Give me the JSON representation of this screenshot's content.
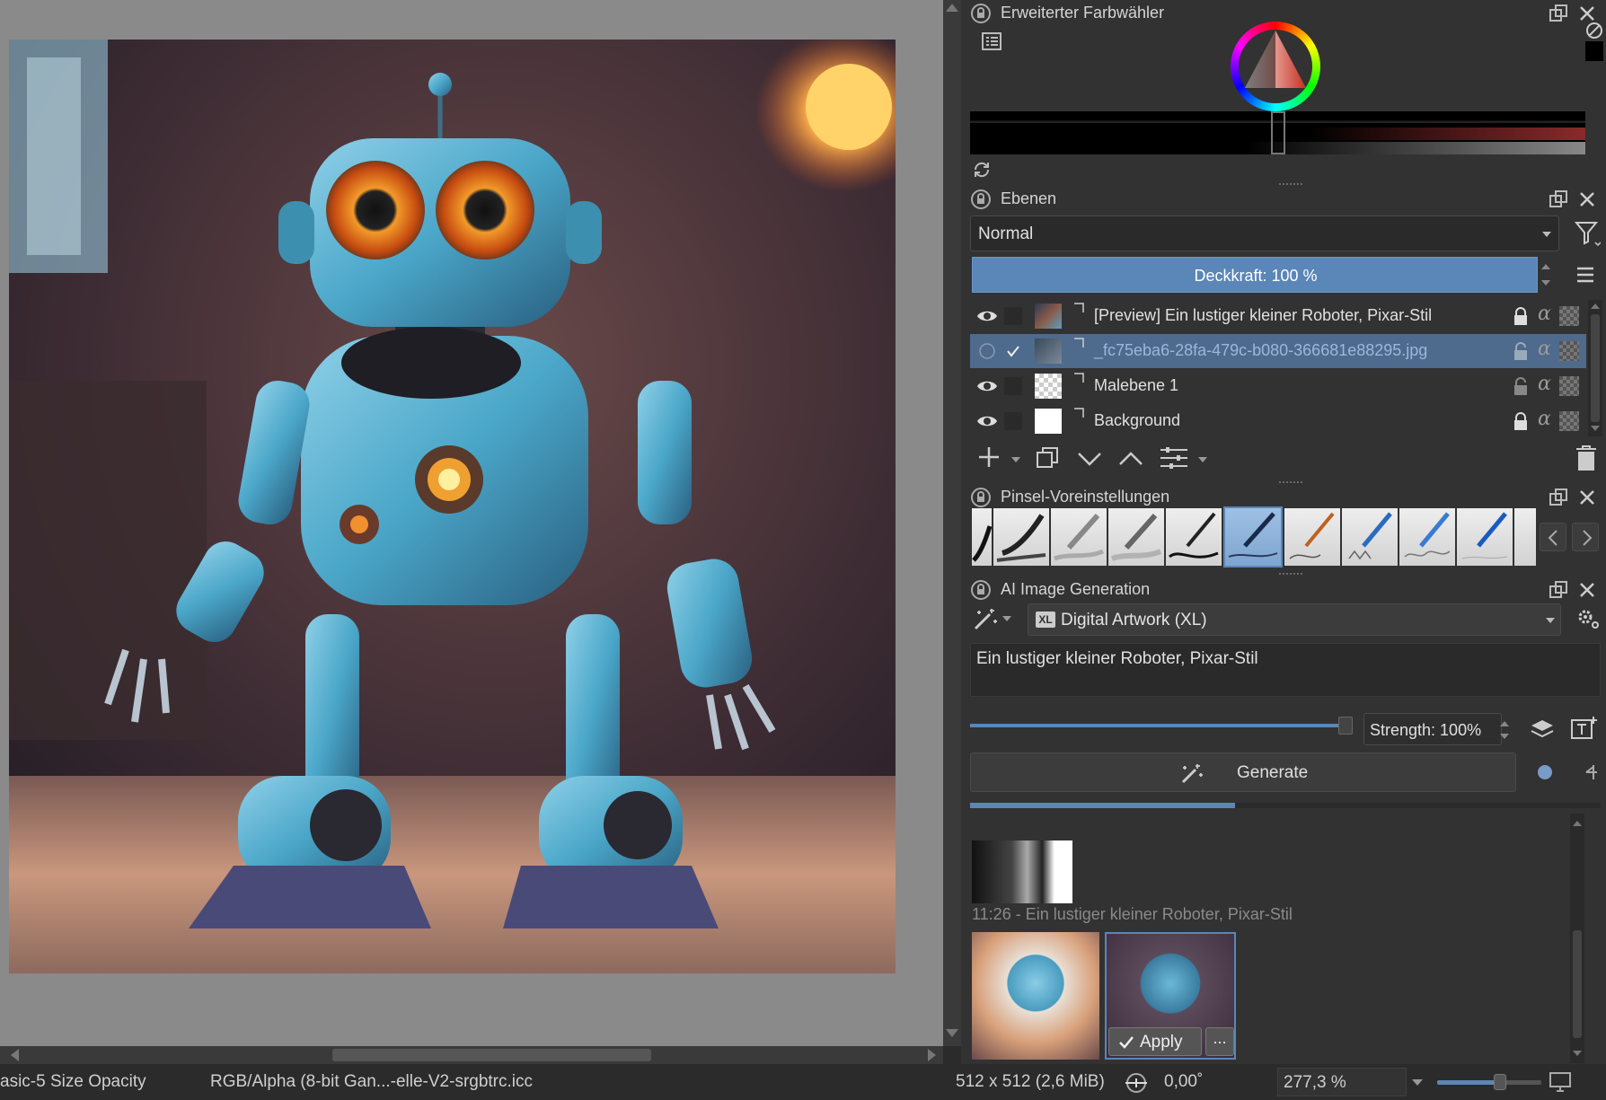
{
  "color_selector": {
    "title": "Erweiterter Farbwähler",
    "current_color": "#000000"
  },
  "layers": {
    "title": "Ebenen",
    "blend_mode": "Normal",
    "opacity_label": "Deckkraft:  100 %",
    "opacity": 1.0,
    "rows": [
      {
        "name": "[Preview] Ein lustiger kleiner Roboter, Pixar-Stil",
        "visible": true,
        "selected": false,
        "locked": true
      },
      {
        "name": "_fc75eba6-28fa-479c-b080-366681e88295.jpg",
        "visible": false,
        "selected": true,
        "locked": false
      },
      {
        "name": "Malebene 1",
        "visible": true,
        "selected": false,
        "locked": false
      },
      {
        "name": "Background",
        "visible": true,
        "selected": false,
        "locked": true
      }
    ]
  },
  "brush_presets": {
    "title": "Pinsel-Voreinstellungen",
    "selected_index": 5
  },
  "ai_generation": {
    "title": "AI Image Generation",
    "style": "Digital Artwork (XL)",
    "style_badge": "XL",
    "prompt": "Ein lustiger kleiner Roboter, Pixar-Stil",
    "strength_label": "Strength: 100%",
    "strength": 1.0,
    "generate_label": "Generate",
    "progress": 0.42,
    "history_caption": "11:26 - Ein lustiger kleiner Roboter, Pixar-Stil",
    "apply_label": "Apply",
    "more_label": "..."
  },
  "statusbar": {
    "brush": "asic-5 Size Opacity",
    "color_profile": "RGB/Alpha (8-bit Gan...-elle-V2-srgbtrc.icc",
    "image_size": "512 x 512 (2,6 MiB)",
    "rotation": "0,00˚",
    "zoom": "277,3 %",
    "zoom_level": 0.6
  },
  "colors": {
    "accent": "#5a86b8",
    "selection": "#4e6a8c",
    "panel": "#323232"
  }
}
